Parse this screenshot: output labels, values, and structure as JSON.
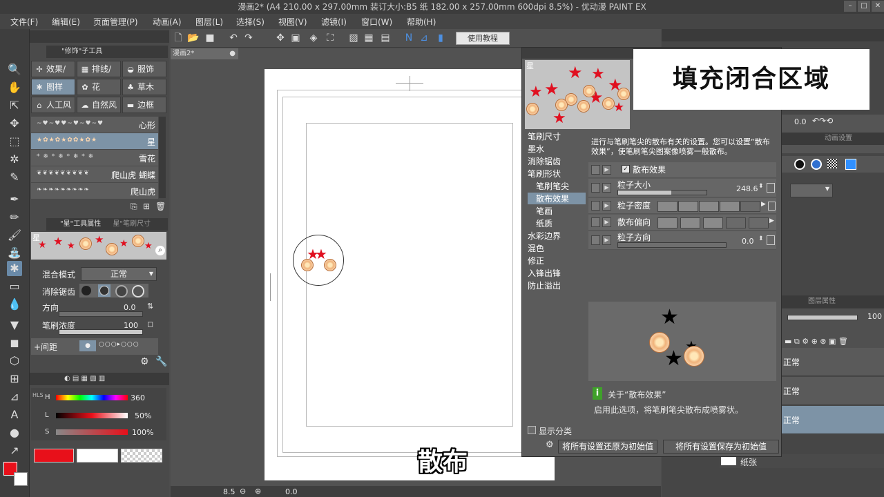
{
  "window": {
    "title": "漫画2* (A4 210.00 x 297.00mm 装订大小:B5 纸 182.00 x 257.00mm 600dpi 8.5%) - 优动漫 PAINT EX",
    "min": "–",
    "max": "□",
    "close": "✕"
  },
  "menu": [
    "文件(F)",
    "编辑(E)",
    "页面管理(P)",
    "动画(A)",
    "图层(L)",
    "选择(S)",
    "视图(V)",
    "滤镜(I)",
    "窗口(W)",
    "帮助(H)"
  ],
  "toolbar": {
    "tutorial_label": "使用教程"
  },
  "left_panel": {
    "subtool_tab": "\"修饰\"子工具",
    "subtool_buttons": [
      {
        "label": "效果/",
        "icon": "✢"
      },
      {
        "label": "排线/",
        "icon": "▦"
      },
      {
        "label": "服饰",
        "icon": "◒"
      },
      {
        "label": "图样",
        "icon": "✱"
      },
      {
        "label": "花",
        "icon": "✿"
      },
      {
        "label": "草木",
        "icon": "♣"
      },
      {
        "label": "人工风",
        "icon": "⌂"
      },
      {
        "label": "自然风",
        "icon": "☁"
      },
      {
        "label": "边框",
        "icon": "▬"
      }
    ],
    "brushes": [
      {
        "label": "心形",
        "stroke": "~♥~♥♥~♥~♥~♥"
      },
      {
        "label": "星",
        "stroke": "★✿★✿★✿✿★✿★"
      },
      {
        "label": "雪花",
        "stroke": "* ❄ * ❄ * ❄ * ❄"
      },
      {
        "label": "爬山虎 蝴蝶",
        "stroke": "❦❦❦❦❦❦❦❦❦"
      },
      {
        "label": "爬山虎",
        "stroke": "❧❧❧❧❧❧❧❧❧"
      }
    ],
    "tool_prop_tab": "\"星\"工具属性",
    "tool_prop_tab2": "星\"笔刷尺寸",
    "brush_preview_name": "星",
    "props": {
      "blend_label": "混合模式",
      "blend_value": "正常",
      "aa_label": "消除锯齿",
      "direction_label": "方向",
      "direction_value": "0.0",
      "density_label": "笔刷浓度",
      "density_value": "100",
      "spacing_label": "+间距"
    },
    "color": {
      "h_label": "H",
      "h_value": "360",
      "l_label": "L",
      "l_value": "50%",
      "s_label": "S",
      "s_value": "100%",
      "hls_label": "HLS",
      "main_color": "#e8101a",
      "sub_color": "#ffffff"
    }
  },
  "canvas": {
    "doc_tab": "漫画2*",
    "zoom": "8.5",
    "angle": "0.0"
  },
  "dialog": {
    "preview_name": "星",
    "categories": [
      {
        "label": "笔刷尺寸",
        "sub": false
      },
      {
        "label": "墨水",
        "sub": false
      },
      {
        "label": "消除锯齿",
        "sub": false
      },
      {
        "label": "笔刷形状",
        "sub": false
      },
      {
        "label": "笔刷笔尖",
        "sub": true
      },
      {
        "label": "散布效果",
        "sub": true,
        "selected": true
      },
      {
        "label": "笔画",
        "sub": true
      },
      {
        "label": "纸质",
        "sub": true
      },
      {
        "label": "水彩边界",
        "sub": false
      },
      {
        "label": "混色",
        "sub": false
      },
      {
        "label": "修正",
        "sub": false
      },
      {
        "label": "入锋出锋",
        "sub": false
      },
      {
        "label": "防止溢出",
        "sub": false
      }
    ],
    "show_category": "显示分类",
    "description": "进行与笔刷笔尖的散布有关的设置。您可以设置“散布效果”，使笔刷笔尖图案像喷雾一般散布。",
    "scatter_label": "散布效果",
    "particle_size_label": "粒子大小",
    "particle_size_value": "248.6",
    "particle_size_fraction": 0.6,
    "particle_density_label": "粒子密度",
    "scatter_bias_label": "散布偏向",
    "particle_direction_label": "粒子方向",
    "particle_direction_value": "0.0",
    "info_title": "关于“散布效果”",
    "info_text": "启用此选项，将笔刷笔尖散布成喷雾状。",
    "reset_button": "将所有设置还原为初始值",
    "save_button": "将所有设置保存为初始值"
  },
  "right_panel": {
    "tab_label": "动画设置",
    "layer_tab": "图层属性",
    "opacity_value": "100",
    "nav_zoom": "0.0",
    "layers": [
      {
        "label": "正常"
      },
      {
        "label": "正常"
      },
      {
        "label": "正常",
        "selected": true
      }
    ],
    "paper_layer": "纸张"
  },
  "overlays": {
    "title": "填充闭合区域",
    "subtitle": "散布"
  }
}
